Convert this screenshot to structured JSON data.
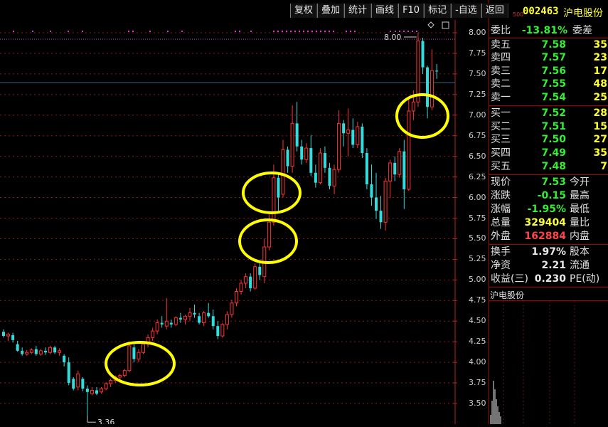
{
  "toolbar": {
    "items": [
      "复权",
      "叠加",
      "统计",
      "画线",
      "F10",
      "标记",
      "-自选",
      "返回"
    ]
  },
  "chart": {
    "y_ticks": [
      "8.00",
      "7.75",
      "7.50",
      "7.25",
      "7.00",
      "6.75",
      "6.50",
      "6.25",
      "6.00",
      "5.75",
      "5.50",
      "5.25",
      "5.00",
      "4.75",
      "4.50",
      "4.25",
      "4.00",
      "3.75",
      "3.50"
    ],
    "high_label": "8.00",
    "low_label": "3.36",
    "colors": {
      "up": "#ff3333",
      "down": "#33dddd",
      "circle": "#ffff00",
      "marker": "#dd33dd",
      "grid": "#8a1a1a"
    }
  },
  "chart_data": {
    "type": "candlestick",
    "title": "",
    "xlabel": "",
    "ylabel": "",
    "ylim": [
      3.3,
      8.1
    ],
    "annotations": [
      "8.00",
      "3.36"
    ],
    "series": [
      {
        "values": [
          [
            4.37,
            4.4,
            4.3,
            4.32
          ],
          [
            4.32,
            4.36,
            4.26,
            4.34
          ],
          [
            4.33,
            4.36,
            4.24,
            4.27
          ],
          [
            4.22,
            4.26,
            4.13,
            4.14
          ],
          [
            4.14,
            4.18,
            4.08,
            4.1
          ],
          [
            4.1,
            4.15,
            4.08,
            4.12
          ],
          [
            4.12,
            4.17,
            4.1,
            4.15
          ],
          [
            4.16,
            4.2,
            4.08,
            4.1
          ],
          [
            4.1,
            4.16,
            4.08,
            4.14
          ],
          [
            4.14,
            4.18,
            4.09,
            4.12
          ],
          [
            4.12,
            4.2,
            4.1,
            4.18
          ],
          [
            4.18,
            4.2,
            4.1,
            4.12
          ],
          [
            4.12,
            4.17,
            4.08,
            4.14
          ],
          [
            4.08,
            4.1,
            3.95,
            4.0
          ],
          [
            4.0,
            4.06,
            3.72,
            3.75
          ],
          [
            3.8,
            3.82,
            3.66,
            3.68
          ],
          [
            3.7,
            3.9,
            3.66,
            3.86
          ],
          [
            3.8,
            3.82,
            3.65,
            3.68
          ],
          [
            3.68,
            3.72,
            3.36,
            3.64
          ],
          [
            3.62,
            3.7,
            3.6,
            3.66
          ],
          [
            3.66,
            3.7,
            3.6,
            3.62
          ],
          [
            3.64,
            3.7,
            3.62,
            3.68
          ],
          [
            3.68,
            3.76,
            3.66,
            3.74
          ],
          [
            3.74,
            3.8,
            3.7,
            3.78
          ],
          [
            3.78,
            3.84,
            3.75,
            3.82
          ],
          [
            3.82,
            3.86,
            3.78,
            3.84
          ],
          [
            3.84,
            3.92,
            3.82,
            3.9
          ],
          [
            3.9,
            4.24,
            3.88,
            4.2
          ],
          [
            4.18,
            4.22,
            4.0,
            4.04
          ],
          [
            4.04,
            4.16,
            4.0,
            4.12
          ],
          [
            4.12,
            4.24,
            4.1,
            4.22
          ],
          [
            4.22,
            4.34,
            4.18,
            4.3
          ],
          [
            4.3,
            4.42,
            4.26,
            4.38
          ],
          [
            4.38,
            4.52,
            4.34,
            4.48
          ],
          [
            4.48,
            4.56,
            4.42,
            4.46
          ],
          [
            4.44,
            4.78,
            4.4,
            4.5
          ],
          [
            4.48,
            4.52,
            4.42,
            4.46
          ],
          [
            4.46,
            4.56,
            4.44,
            4.54
          ],
          [
            4.54,
            4.6,
            4.48,
            4.52
          ],
          [
            4.52,
            4.58,
            4.46,
            4.56
          ],
          [
            4.56,
            4.66,
            4.5,
            4.6
          ],
          [
            4.6,
            4.7,
            4.54,
            4.58
          ],
          [
            4.56,
            4.6,
            4.46,
            4.48
          ],
          [
            4.48,
            4.62,
            4.44,
            4.6
          ],
          [
            4.6,
            4.72,
            4.54,
            4.56
          ],
          [
            4.56,
            4.64,
            4.4,
            4.44
          ],
          [
            4.44,
            4.5,
            4.28,
            4.32
          ],
          [
            4.32,
            4.48,
            4.3,
            4.46
          ],
          [
            4.46,
            4.62,
            4.4,
            4.58
          ],
          [
            4.58,
            4.76,
            4.54,
            4.72
          ],
          [
            4.72,
            4.9,
            4.68,
            4.86
          ],
          [
            4.86,
            5.0,
            4.82,
            4.96
          ],
          [
            4.96,
            5.08,
            4.9,
            5.04
          ],
          [
            5.04,
            5.08,
            4.86,
            4.9
          ],
          [
            4.9,
            5.2,
            4.88,
            5.16
          ],
          [
            5.16,
            5.24,
            5.0,
            5.06
          ],
          [
            5.04,
            5.5,
            4.96,
            5.4
          ],
          [
            5.4,
            5.8,
            5.36,
            5.7
          ],
          [
            5.7,
            6.4,
            5.66,
            6.24
          ],
          [
            6.24,
            6.3,
            5.84,
            6.0
          ],
          [
            6.04,
            6.7,
            6.0,
            6.58
          ],
          [
            6.58,
            6.62,
            6.3,
            6.38
          ],
          [
            6.38,
            7.12,
            6.3,
            6.9
          ],
          [
            6.9,
            7.16,
            6.56,
            6.62
          ],
          [
            6.62,
            6.7,
            6.4,
            6.46
          ],
          [
            6.46,
            6.66,
            6.42,
            6.6
          ],
          [
            6.6,
            6.76,
            6.26,
            6.3
          ],
          [
            6.3,
            6.4,
            6.12,
            6.18
          ],
          [
            6.18,
            6.6,
            6.16,
            6.54
          ],
          [
            6.54,
            6.62,
            6.3,
            6.36
          ],
          [
            6.36,
            6.42,
            6.1,
            6.14
          ],
          [
            6.14,
            6.4,
            6.04,
            6.34
          ],
          [
            6.34,
            7.06,
            6.3,
            6.9
          ],
          [
            6.9,
            6.94,
            6.62,
            6.78
          ],
          [
            6.78,
            7.08,
            6.5,
            6.82
          ],
          [
            6.82,
            6.96,
            6.6,
            6.64
          ],
          [
            6.64,
            6.92,
            6.6,
            6.86
          ],
          [
            6.86,
            6.9,
            6.48,
            6.54
          ],
          [
            6.54,
            6.6,
            6.1,
            6.16
          ],
          [
            6.16,
            6.4,
            5.9,
            6.0
          ],
          [
            6.0,
            6.3,
            5.74,
            5.84
          ],
          [
            5.84,
            6.02,
            5.62,
            5.7
          ],
          [
            5.7,
            6.24,
            5.6,
            6.2
          ],
          [
            6.2,
            6.46,
            6.0,
            6.42
          ],
          [
            6.42,
            6.5,
            6.2,
            6.28
          ],
          [
            6.28,
            6.6,
            6.24,
            6.56
          ],
          [
            6.56,
            6.7,
            5.86,
            6.1
          ],
          [
            6.1,
            7.2,
            6.08,
            7.05
          ],
          [
            7.05,
            7.3,
            6.94,
            7.16
          ],
          [
            7.16,
            8.0,
            7.1,
            7.9
          ],
          [
            7.9,
            7.94,
            7.5,
            7.58
          ],
          [
            7.58,
            7.6,
            6.96,
            7.1
          ],
          [
            7.1,
            7.8,
            7.06,
            7.54
          ],
          [
            7.54,
            7.62,
            7.44,
            7.53
          ]
        ]
      }
    ]
  },
  "quote": {
    "small_tag": "500",
    "code": "002463",
    "name": "沪电股份",
    "weibi": {
      "label": "委比",
      "value": "-13.81%",
      "right": "委差"
    },
    "sells": [
      {
        "label": "卖五",
        "price": "7.58",
        "vol": "35"
      },
      {
        "label": "卖四",
        "price": "7.57",
        "vol": "23"
      },
      {
        "label": "卖三",
        "price": "7.56",
        "vol": "17"
      },
      {
        "label": "卖二",
        "price": "7.55",
        "vol": "48"
      },
      {
        "label": "卖一",
        "price": "7.54",
        "vol": "25"
      }
    ],
    "buys": [
      {
        "label": "买一",
        "price": "7.52",
        "vol": "28"
      },
      {
        "label": "买二",
        "price": "7.51",
        "vol": "15"
      },
      {
        "label": "买三",
        "price": "7.50",
        "vol": "27"
      },
      {
        "label": "买四",
        "price": "7.49",
        "vol": "35"
      },
      {
        "label": "买五",
        "price": "7.48",
        "vol": "7"
      }
    ],
    "stats": [
      {
        "label": "现价",
        "value": "7.53",
        "right": "今开",
        "color": "#33ee33"
      },
      {
        "label": "涨跌",
        "value": "-0.15",
        "right": "最高",
        "color": "#33ee33"
      },
      {
        "label": "涨幅",
        "value": "-1.95%",
        "right": "最低",
        "color": "#33ee33"
      },
      {
        "label": "总量",
        "value": "329404",
        "right": "量比",
        "color": "#ffff33"
      },
      {
        "label": "外盘",
        "value": "162884",
        "right": "内盘",
        "color": "#ff4444"
      }
    ],
    "stats2": [
      {
        "label": "换手",
        "value": "1.97%",
        "right": "股本"
      },
      {
        "label": "净资",
        "value": "2.21",
        "right": "流通"
      },
      {
        "label": "收益(三)",
        "value": "0.230",
        "right": "PE(动)"
      }
    ],
    "mini_title": "沪电股份"
  }
}
